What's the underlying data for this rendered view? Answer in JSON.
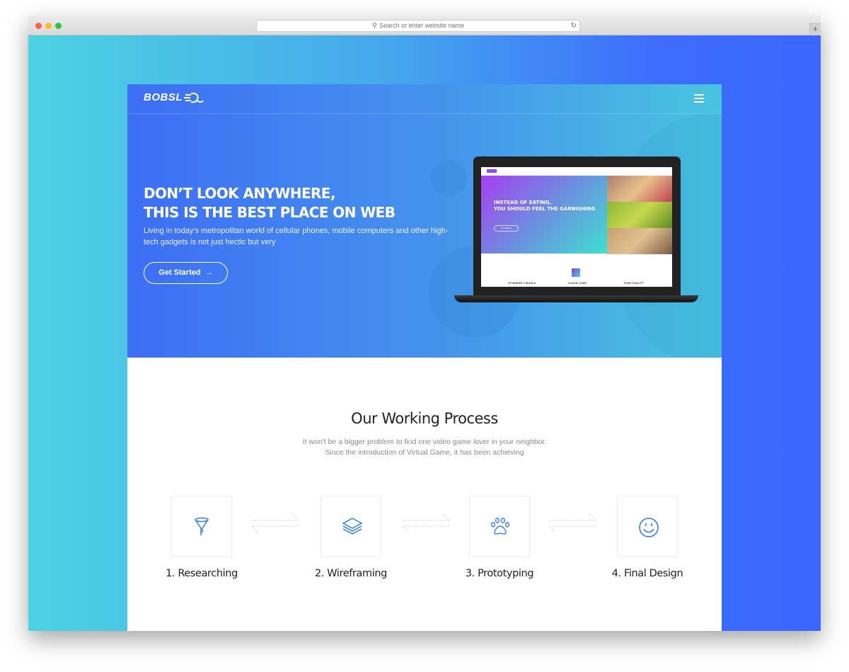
{
  "browser": {
    "url_placeholder": "Search or enter website name",
    "new_tab": "+"
  },
  "site": {
    "logo": "BOBSL",
    "hero": {
      "title_line1": "DON’T LOOK ANYWHERE,",
      "title_line2": "THIS IS THE BEST PLACE ON WEB",
      "subtitle": "Living in today’s metropolitan world of cellular phones, mobile computers and other high-tech gadgets is not just hectic but very",
      "cta": "Get Started",
      "mockup": {
        "title_line1": "INSTEAD OF EATING,",
        "title_line2": "YOU SHOULD FEEL THE GARNISHING",
        "cta": "Get Started",
        "features": [
          "STUNNING VISUALS",
          "CLEAN CODE",
          "PUNCTUALITY"
        ]
      }
    },
    "process": {
      "title": "Our Working Process",
      "desc_line1": "It won't be a bigger problem to find one video game lover in your neighbor.",
      "desc_line2": "Since the introduction of Virtual Game, it has been achieving",
      "steps": [
        {
          "label": "1. Researching",
          "icon": "funnel-icon"
        },
        {
          "label": "2. Wireframing",
          "icon": "layers-icon"
        },
        {
          "label": "3. Prototyping",
          "icon": "paw-icon"
        },
        {
          "label": "4. Final Design",
          "icon": "smiley-icon"
        }
      ]
    }
  },
  "colors": {
    "accent": "#2f6cf6",
    "hero_start": "#3d6ef6",
    "hero_end": "#48c5de"
  }
}
